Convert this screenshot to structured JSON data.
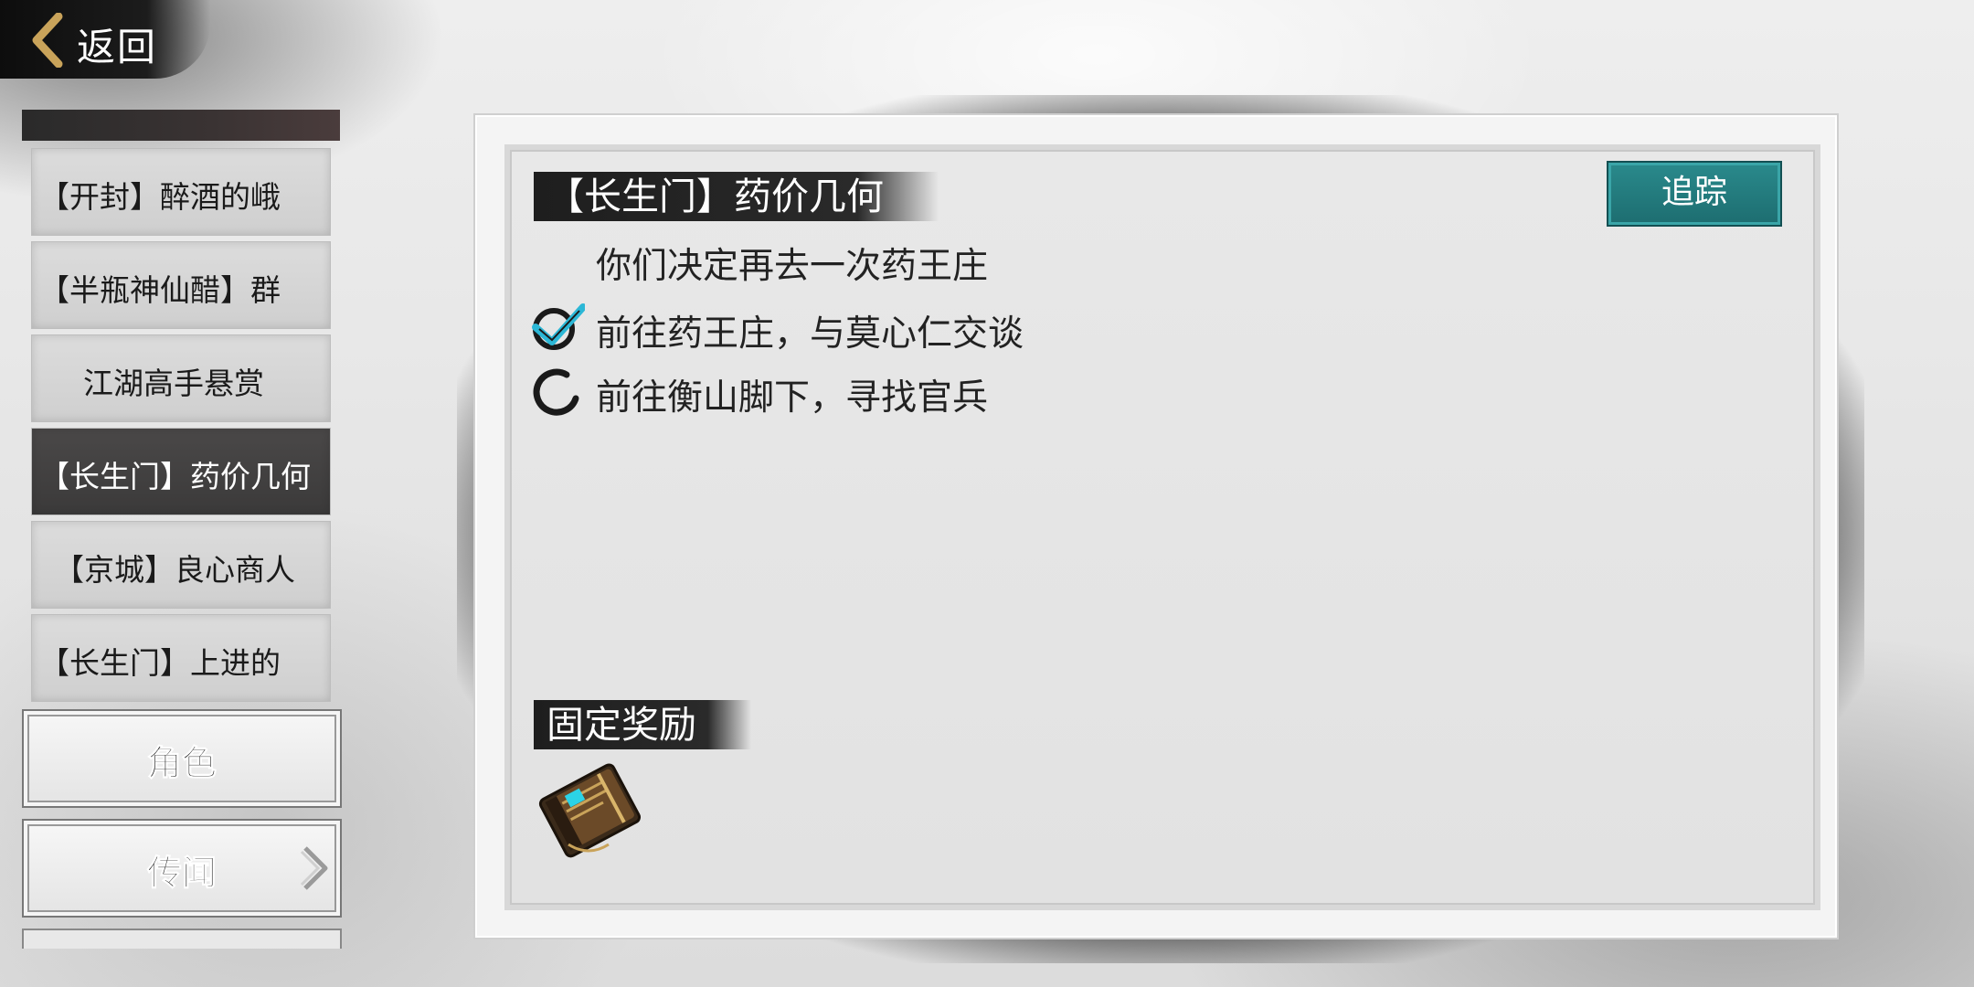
{
  "back": {
    "label": "返回"
  },
  "quest_list": [
    {
      "label": "【开封】醉酒的峨",
      "active": false
    },
    {
      "label": "【半瓶神仙醋】群",
      "active": false
    },
    {
      "label": "江湖高手悬赏",
      "active": false
    },
    {
      "label": "【长生门】药价几何",
      "active": true
    },
    {
      "label": "【京城】良心商人",
      "active": false
    },
    {
      "label": "【长生门】上进的",
      "active": false
    }
  ],
  "tabs": {
    "character": "角色",
    "rumors": "传闻"
  },
  "quest": {
    "title": "【长生门】药价几何",
    "track_label": "追踪",
    "description": "你们决定再去一次药王庄",
    "tasks": [
      {
        "text": "前往药王庄，与莫心仁交谈",
        "status": "completed",
        "icon": "check-icon"
      },
      {
        "text": "前往衡山脚下，寻找官兵",
        "status": "in-progress",
        "icon": "ink-circle-icon"
      }
    ],
    "reward_title": "固定奖励",
    "rewards": [
      {
        "icon": "book-item-icon"
      }
    ]
  },
  "colors": {
    "accent_teal": "#1f7376",
    "check_blue": "#2bb7d6",
    "ink": "#1e1e1e"
  }
}
